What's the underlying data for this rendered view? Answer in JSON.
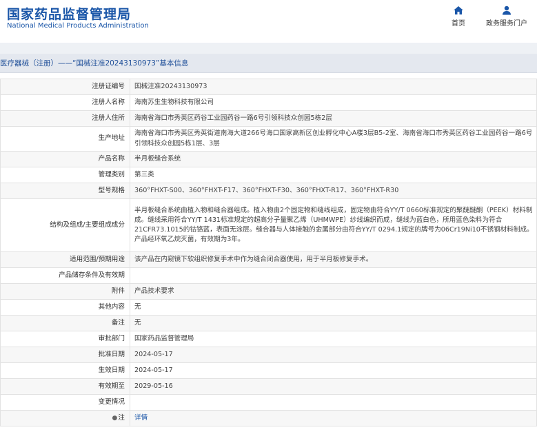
{
  "header": {
    "site_name_cn": "国家药品监督管理局",
    "site_name_en": "National Medical Products Administration",
    "nav": {
      "home": "首页",
      "gov_portal": "政务服务门户"
    }
  },
  "breadcrumb": "医疗器械（注册）——“国械注准20243130973”基本信息",
  "rows": [
    {
      "label": "注册证编号",
      "value": "国械注准20243130973"
    },
    {
      "label": "注册人名称",
      "value": "海南苏生生物科技有限公司"
    },
    {
      "label": "注册人住所",
      "value": "海南省海口市秀英区药谷工业园药谷一路6号引领科技众创园5栋2层"
    },
    {
      "label": "生产地址",
      "value": "海南省海口市秀英区秀英街道南海大道266号海口国家高新区创业孵化中心A楼3层B5-2室、海南省海口市秀英区药谷工业园药谷一路6号引领科技众创园5栋1层、3层"
    },
    {
      "label": "产品名称",
      "value": "半月板缝合系统"
    },
    {
      "label": "管理类别",
      "value": "第三类"
    },
    {
      "label": "型号规格",
      "value": "360°FHXT-S00、360°FHXT-F17、360°FHXT-F30、360°FHXT-R17、360°FHXT-R30"
    },
    {
      "label": "结构及组成/主要组成成分",
      "value": "半月板缝合系统由植入物和缝合器组成。植入物由2个固定物和缝线组成，固定物由符合YY/T 0660标准规定的聚醚醚酮（PEEK）材料制成。缝线采用符合YY/T 1431标准规定的超高分子量聚乙烯（UHMWPE）纱线编织而成，缝线为蓝白色，所用蓝色染料为符合21CFR73.1015的钴铬蓝，表面无涂层。缝合器与人体接触的金属部分由符合YY/T 0294.1规定的牌号为06Cr19Ni10不锈钢材料制成。产品经环氧乙烷灭菌，有效期为3年。"
    },
    {
      "label": "适用范围/预期用途",
      "value": "该产品在内窥镜下软组织修复手术中作为缝合闭合器使用，用于半月板修复手术。"
    },
    {
      "label": "产品储存条件及有效期",
      "value": ""
    },
    {
      "label": "附件",
      "value": "产品技术要求"
    },
    {
      "label": "其他内容",
      "value": "无"
    },
    {
      "label": "备注",
      "value": "无"
    },
    {
      "label": "审批部门",
      "value": "国家药品监督管理局"
    },
    {
      "label": "批准日期",
      "value": "2024-05-17"
    },
    {
      "label": "生效日期",
      "value": "2024-05-17"
    },
    {
      "label": "有效期至",
      "value": "2029-05-16"
    },
    {
      "label": "变更情况",
      "value": ""
    },
    {
      "label": "注",
      "value": "详情"
    }
  ]
}
